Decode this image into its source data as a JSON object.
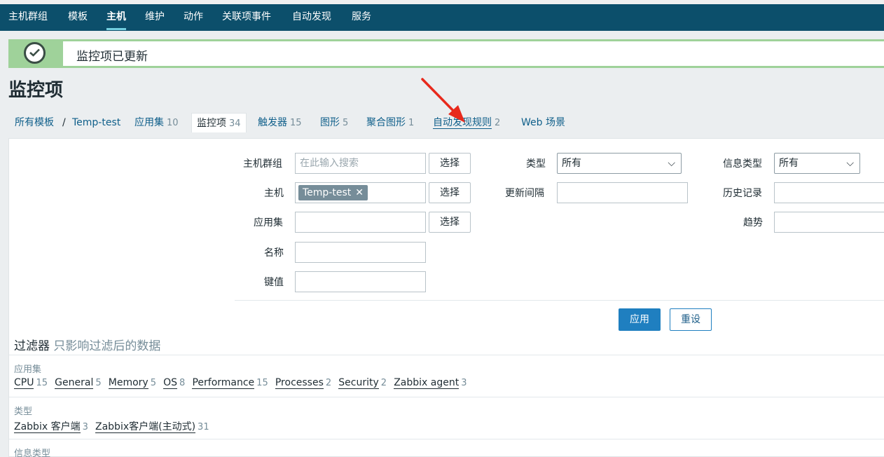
{
  "nav": {
    "items": [
      "主机群组",
      "模板",
      "主机",
      "维护",
      "动作",
      "关联项事件",
      "自动发现",
      "服务"
    ],
    "active": "主机"
  },
  "message": {
    "text": "监控项已更新",
    "icon": "check-circle-icon"
  },
  "page": {
    "title": "监控项"
  },
  "breadcrumb": {
    "all_templates": "所有模板",
    "separator": "/",
    "template": "Temp-test",
    "tabs": [
      {
        "label": "应用集",
        "count": "10"
      },
      {
        "label": "监控项",
        "count": "34"
      },
      {
        "label": "触发器",
        "count": "15"
      },
      {
        "label": "图形",
        "count": "5"
      },
      {
        "label": "聚合图形",
        "count": "1"
      },
      {
        "label": "自动发现规则",
        "count": "2"
      },
      {
        "label": "Web 场景",
        "count": ""
      }
    ]
  },
  "filter": {
    "host_group_label": "主机群组",
    "host_group_placeholder": "在此输入搜索",
    "host_label": "主机",
    "host_tag": "Temp-test",
    "application_label": "应用集",
    "name_label": "名称",
    "key_label": "键值",
    "select_button": "选择",
    "type_label": "类型",
    "type_value": "所有",
    "update_interval_label": "更新间隔",
    "info_type_label": "信息类型",
    "info_type_value": "所有",
    "history_label": "历史记录",
    "trends_label": "趋势",
    "apply_button": "应用",
    "reset_button": "重设"
  },
  "subfilter": {
    "title": "过滤器",
    "note": "只影响过滤后的数据",
    "groups": [
      {
        "label": "应用集",
        "items": [
          {
            "name": "CPU",
            "count": "15"
          },
          {
            "name": "General",
            "count": "5"
          },
          {
            "name": "Memory",
            "count": "5"
          },
          {
            "name": "OS",
            "count": "8"
          },
          {
            "name": "Performance",
            "count": "15"
          },
          {
            "name": "Processes",
            "count": "2"
          },
          {
            "name": "Security",
            "count": "2"
          },
          {
            "name": "Zabbix agent",
            "count": "3"
          }
        ]
      },
      {
        "label": "类型",
        "items": [
          {
            "name": "Zabbix 客户端",
            "count": "3"
          },
          {
            "name": "Zabbix客户端(主动式)",
            "count": "31"
          }
        ]
      },
      {
        "label": "信息类型",
        "items": []
      }
    ]
  },
  "colors": {
    "nav_bg": "#0c4f6b",
    "link": "#0f5f8a",
    "success": "#9fd29a",
    "primary_button": "#1f7fc0",
    "annotation_arrow": "#e8291c"
  }
}
